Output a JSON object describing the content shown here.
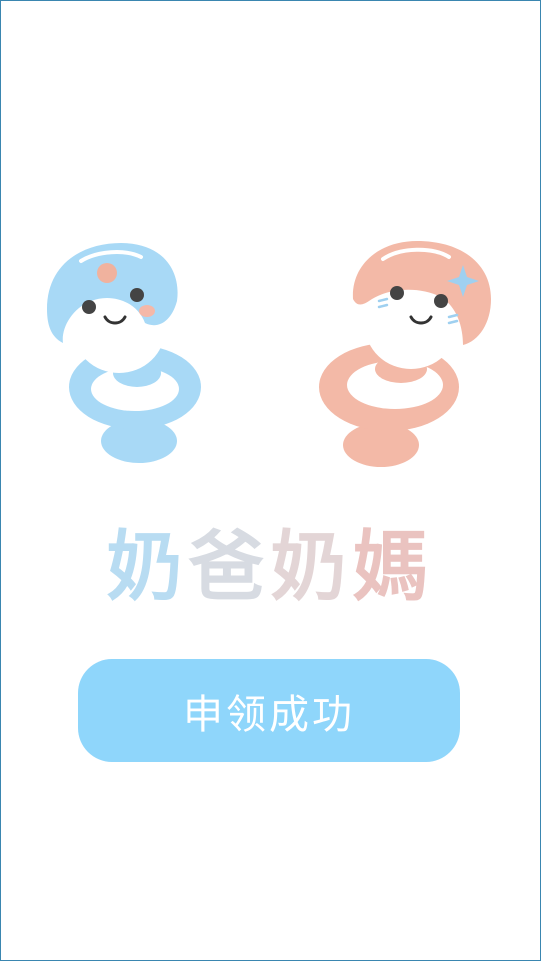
{
  "title": {
    "chars": [
      "奶",
      "爸",
      "奶",
      "媽"
    ],
    "colors": [
      "#b8dcf2",
      "#d7dbe2",
      "#e3d5d6",
      "#eac3c0"
    ]
  },
  "success_button": {
    "label": "申领成功",
    "color": "#8fd6fb"
  },
  "mascots": [
    {
      "name": "blue-pacifier-mascot",
      "color": "#a8d9f6"
    },
    {
      "name": "pink-pacifier-mascot",
      "color": "#f3b9a7"
    }
  ]
}
